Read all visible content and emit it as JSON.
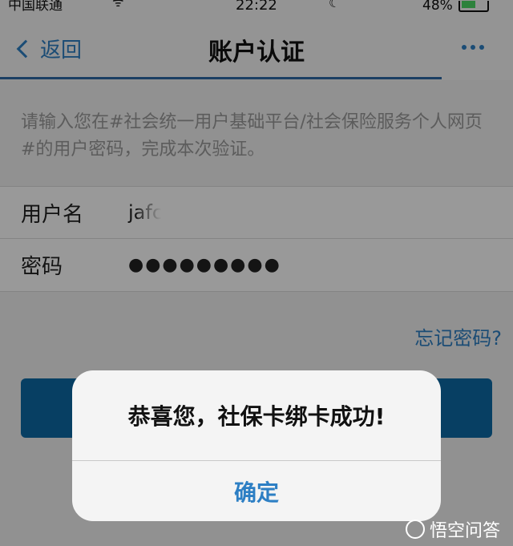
{
  "status_bar": {
    "carrier": "中国联通",
    "time": "22:22",
    "battery_pct": "48%"
  },
  "nav": {
    "back_label": "返回",
    "title": "账户认证"
  },
  "hint_text": "请输入您在#社会统一用户基础平台/社会保险服务个人网页#的用户密码，完成本次验证。",
  "form": {
    "username_label": "用户名",
    "username_value": "jafco",
    "password_label": "密码",
    "password_value": "●●●●●●●●●"
  },
  "forgot_password": "忘记密码?",
  "alert": {
    "message": "恭喜您，社保卡绑卡成功!",
    "confirm": "确定"
  },
  "watermark": "悟空问答",
  "colors": {
    "accent": "#2d7fc4",
    "button": "#0d6aa6"
  }
}
